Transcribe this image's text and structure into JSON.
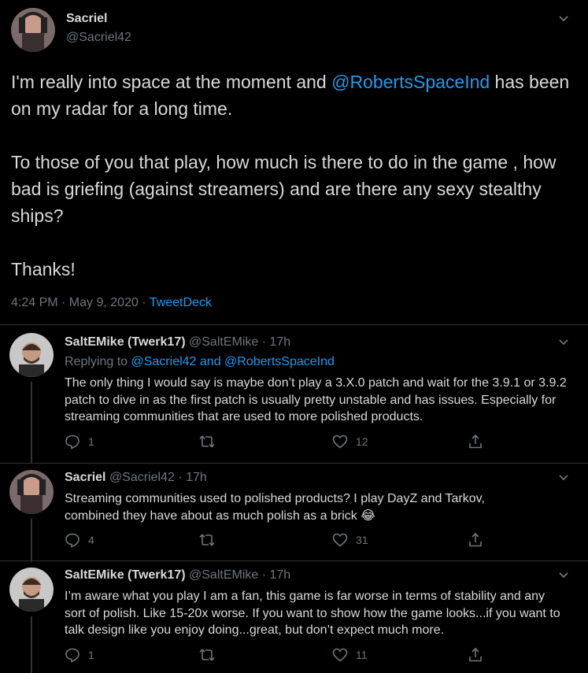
{
  "main_tweet": {
    "display_name": "Sacriel",
    "handle": "@Sacriel42",
    "text_before_mention": "I'm really into space at the moment and ",
    "mention": "@RobertsSpaceInd",
    "text_after_mention": " has been on my radar for a long time.",
    "paragraph2": "To those of you that play, how much is there to do in the game , how bad is griefing (against streamers) and are there any sexy stealthy ships?",
    "paragraph3": "Thanks!",
    "timestamp": "4:24 PM · May 9, 2020 · ",
    "source": "TweetDeck"
  },
  "replies": [
    {
      "display_name": "SaltEMike (Twerk17)",
      "handle": "@SaltEMike",
      "time": " · 17h",
      "replying_prefix": "Replying to ",
      "replying_to": "@Sacriel42 and @RobertsSpaceInd",
      "text": "The only thing I would say is maybe don’t play a 3.X.0 patch and wait for the 3.9.1 or 3.9.2 patch to dive in as the first patch is usually pretty unstable and has issues. Especially for streaming communities that are used to more polished products.",
      "reply_count": "1",
      "retweet_count": "",
      "like_count": "12"
    },
    {
      "display_name": "Sacriel",
      "handle": "@Sacriel42",
      "time": " · 17h",
      "text": "Streaming communities used to polished products? I play DayZ and Tarkov, combined they have about as much polish as a brick 😂",
      "reply_count": "4",
      "retweet_count": "",
      "like_count": "31"
    },
    {
      "display_name": "SaltEMike (Twerk17)",
      "handle": "@SaltEMike",
      "time": " · 17h",
      "text": "I’m aware what you play I am a fan, this game is far worse in terms of stability and any sort of polish.  Like 15-20x worse.  If you want to show how the game looks...if you want to talk design like you enjoy doing...great, but don’t expect much more.",
      "reply_count": "1",
      "retweet_count": "",
      "like_count": "11"
    }
  ],
  "colors": {
    "background": "#000000",
    "text": "#d9d9d9",
    "muted": "#6e767d",
    "link": "#1d9bf0",
    "border": "#2f3336"
  },
  "icons": [
    "chevron-down-icon",
    "reply-icon",
    "retweet-icon",
    "like-icon",
    "share-icon"
  ]
}
